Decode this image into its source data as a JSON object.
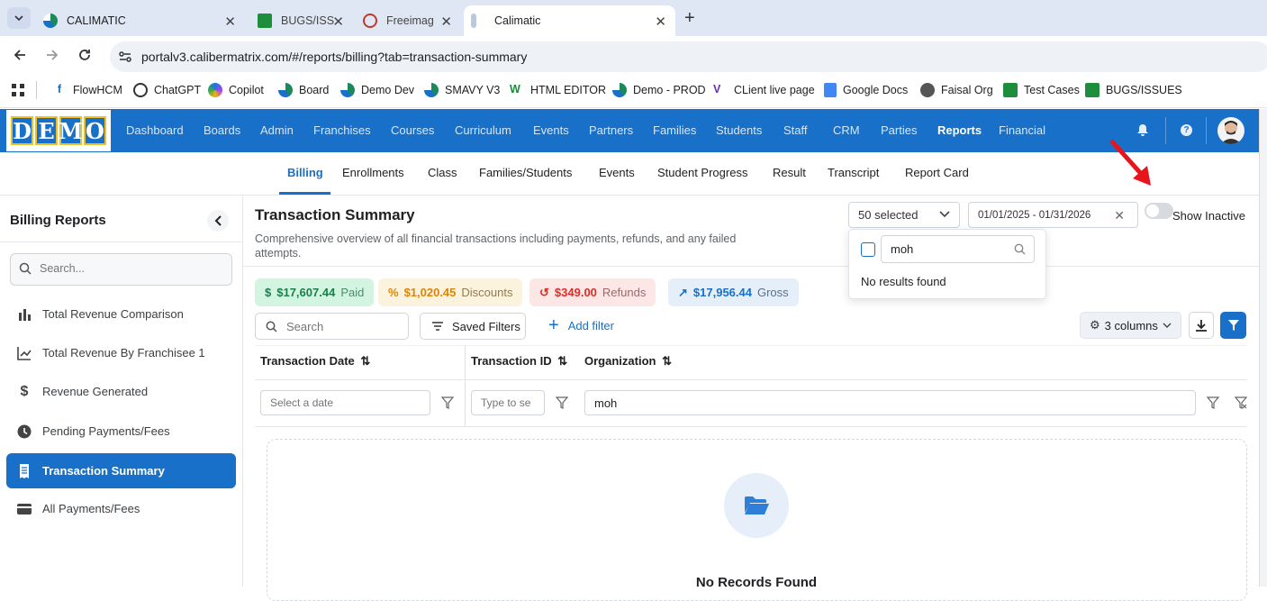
{
  "browser": {
    "tabs": [
      {
        "title": "CALIMATIC"
      },
      {
        "title": "BUGS/ISS"
      },
      {
        "title": "Freeimag"
      },
      {
        "title": "Calimatic"
      }
    ],
    "url": "portalv3.calibermatrix.com/#/reports/billing?tab=transaction-summary",
    "bookmarks": [
      "FlowHCM",
      "ChatGPT",
      "Copilot",
      "Board",
      "Demo Dev",
      "SMAVY V3",
      "HTML EDITOR",
      "Demo - PROD",
      "CLient live page",
      "Google Docs",
      "Faisal Org",
      "Test Cases",
      "BUGS/ISSUES"
    ]
  },
  "app": {
    "logo": [
      "D",
      "E",
      "M",
      "O"
    ],
    "nav": [
      "Dashboard",
      "Boards",
      "Admin",
      "Franchises",
      "Courses",
      "Curriculum",
      "Events",
      "Partners",
      "Families",
      "Students",
      "Staff",
      "CRM",
      "Parties",
      "Reports",
      "Financial"
    ],
    "subnav": [
      "Billing",
      "Enrollments",
      "Class",
      "Families/Students",
      "Events",
      "Student Progress",
      "Result",
      "Transcript",
      "Report Card"
    ]
  },
  "sidebar": {
    "title": "Billing Reports",
    "search_placeholder": "Search...",
    "items": [
      "Total Revenue Comparison",
      "Total Revenue By Franchisee 1",
      "Revenue Generated",
      "Pending Payments/Fees",
      "Transaction Summary",
      "All Payments/Fees"
    ]
  },
  "main": {
    "title": "Transaction Summary",
    "description": "Comprehensive overview of all financial transactions including payments, refunds, and any failed attempts.",
    "org_select": "50 selected",
    "date_range": "01/01/2025 - 01/31/2026",
    "show_inactive": "Show Inactive",
    "dropdown_search": "moh",
    "dropdown_empty": "No results found",
    "chips": [
      {
        "value": "$17,607.44",
        "label": "Paid",
        "symbol": "$"
      },
      {
        "value": "$1,020.45",
        "label": "Discounts",
        "symbol": "%"
      },
      {
        "value": "$349.00",
        "label": "Refunds",
        "symbol": "↺"
      },
      {
        "value": "$17,956.44",
        "label": "Gross",
        "symbol": "↗"
      }
    ],
    "search_placeholder": "Search",
    "saved_filters": "Saved Filters",
    "add_filter": "Add filter",
    "columns_btn": "3 columns",
    "columns": [
      "Transaction Date",
      "Transaction ID",
      "Organization"
    ],
    "filters": {
      "date_placeholder": "Select a date",
      "id_placeholder": "Type to se",
      "org_value": "moh"
    },
    "empty_text": "No Records Found"
  },
  "colors": {
    "brand": "#1870c8",
    "paid": "#1a7f4b",
    "discount": "#d9850b",
    "refund": "#d93025",
    "gross": "#1870c8"
  }
}
